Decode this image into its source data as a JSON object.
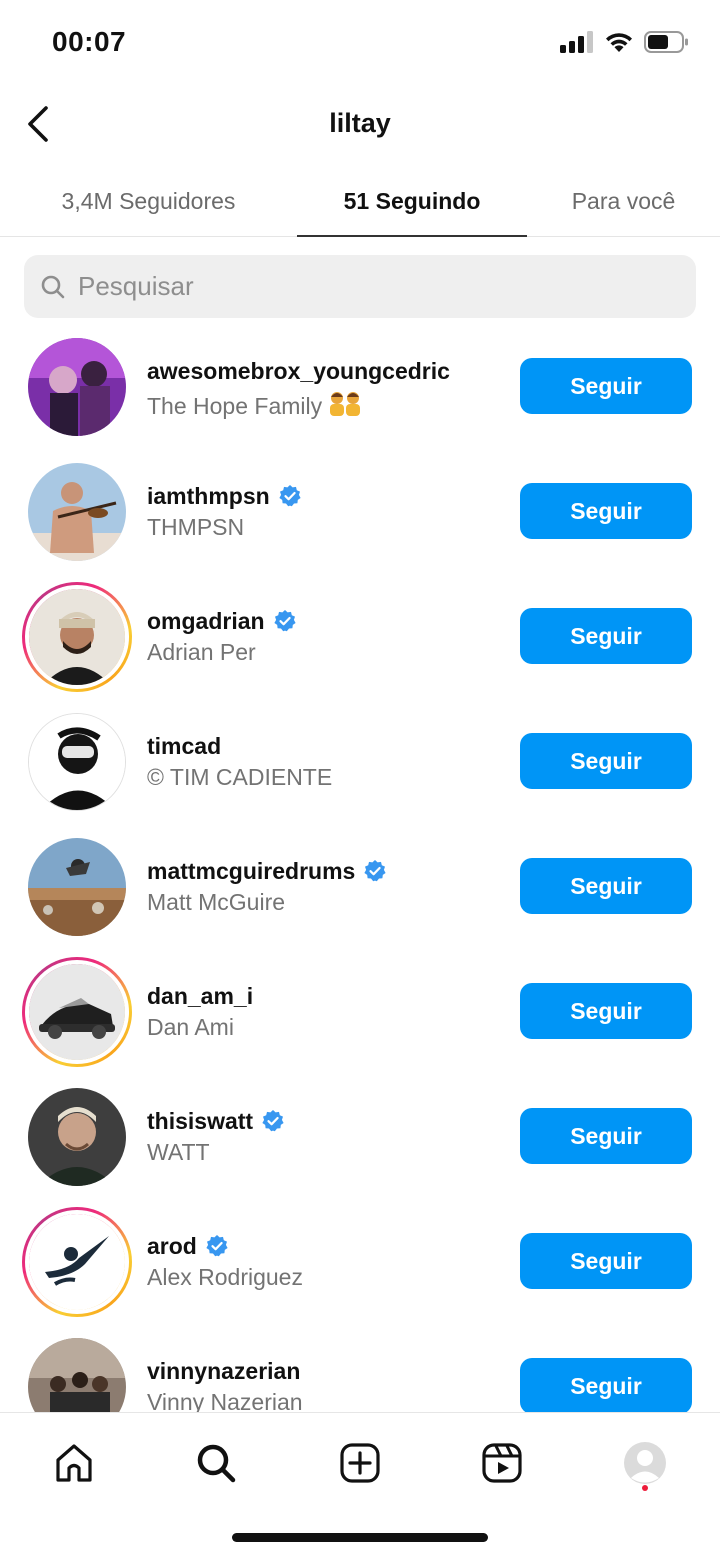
{
  "status_bar": {
    "time": "00:07"
  },
  "header": {
    "title": "liltay"
  },
  "tabs": [
    {
      "label": "3,4M Seguidores",
      "active": false
    },
    {
      "label": "51 Seguindo",
      "active": true
    },
    {
      "label": "Para você",
      "active": false
    }
  ],
  "search": {
    "placeholder": "Pesquisar"
  },
  "accounts": [
    {
      "username": "awesomebrox_youngcedric",
      "name": "The Hope Family",
      "verified": false,
      "story_ring": false,
      "button": "Seguir"
    },
    {
      "username": "iamthmpsn",
      "name": "THMPSN",
      "verified": true,
      "story_ring": false,
      "button": "Seguir"
    },
    {
      "username": "omgadrian",
      "name": "Adrian Per",
      "verified": true,
      "story_ring": true,
      "button": "Seguir"
    },
    {
      "username": "timcad",
      "name": "© TIM CADIENTE",
      "verified": false,
      "story_ring": false,
      "button": "Seguir"
    },
    {
      "username": "mattmcguiredrums",
      "name": "Matt McGuire",
      "verified": true,
      "story_ring": false,
      "button": "Seguir"
    },
    {
      "username": "dan_am_i",
      "name": "Dan Ami",
      "verified": false,
      "story_ring": true,
      "button": "Seguir"
    },
    {
      "username": "thisiswatt",
      "name": "WATT",
      "verified": true,
      "story_ring": false,
      "button": "Seguir"
    },
    {
      "username": "arod",
      "name": "Alex Rodriguez",
      "verified": true,
      "story_ring": true,
      "button": "Seguir"
    },
    {
      "username": "vinnynazerian",
      "name": "Vinny Nazerian",
      "verified": false,
      "story_ring": false,
      "button": "Seguir"
    }
  ],
  "bottom_nav": [
    {
      "icon": "home-icon"
    },
    {
      "icon": "search-icon",
      "active": true
    },
    {
      "icon": "new-post-icon"
    },
    {
      "icon": "reels-icon"
    },
    {
      "icon": "profile-icon",
      "notification_dot": true
    }
  ],
  "colors": {
    "accent": "#0095f6",
    "secondary_text": "#737373",
    "verified": "#3897f0",
    "notification": "#ed1c3a"
  }
}
